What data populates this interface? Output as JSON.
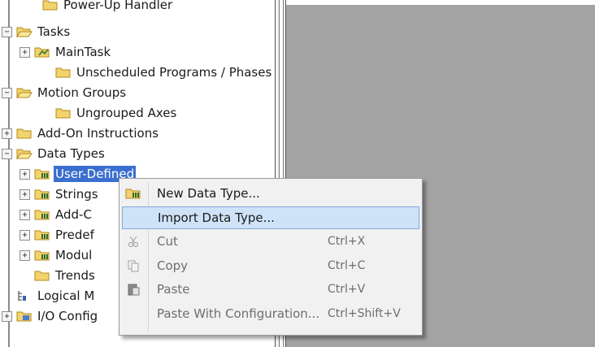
{
  "tree": {
    "items": [
      {
        "label": "Power-Up Handler",
        "expander": "",
        "icon": "folder-icon"
      },
      {
        "label": "Tasks",
        "expander": "−",
        "icon": "folder-open-icon"
      },
      {
        "label": "MainTask",
        "expander": "+",
        "icon": "task-icon"
      },
      {
        "label": "Unscheduled Programs / Phases",
        "expander": "",
        "icon": "folder-icon"
      },
      {
        "label": "Motion Groups",
        "expander": "−",
        "icon": "folder-open-icon"
      },
      {
        "label": "Ungrouped Axes",
        "expander": "",
        "icon": "folder-icon"
      },
      {
        "label": "Add-On Instructions",
        "expander": "+",
        "icon": "folder-icon"
      },
      {
        "label": "Data Types",
        "expander": "−",
        "icon": "folder-open-icon"
      },
      {
        "label": "User-Defined",
        "expander": "+",
        "icon": "datatype-folder-icon",
        "selected": true
      },
      {
        "label": "Strings",
        "expander": "+",
        "icon": "datatype-folder-icon"
      },
      {
        "label": "Add-C",
        "expander": "+",
        "icon": "datatype-folder-icon"
      },
      {
        "label": "Predef",
        "expander": "+",
        "icon": "datatype-folder-icon"
      },
      {
        "label": "Modul",
        "expander": "+",
        "icon": "datatype-folder-icon"
      },
      {
        "label": "Trends",
        "expander": "",
        "icon": "folder-icon"
      },
      {
        "label": "Logical M",
        "expander": "",
        "icon": "logical-model-icon"
      },
      {
        "label": "I/O Config",
        "expander": "+",
        "icon": "io-config-icon"
      }
    ]
  },
  "context_menu": {
    "items": [
      {
        "label": "New Data Type...",
        "shortcut": "",
        "icon": "datatype-folder-icon",
        "enabled": true
      },
      {
        "label": "Import Data Type...",
        "shortcut": "",
        "icon": "",
        "enabled": true,
        "highlighted": true
      },
      {
        "label": "Cut",
        "shortcut": "Ctrl+X",
        "icon": "scissors-icon",
        "enabled": false
      },
      {
        "label": "Copy",
        "shortcut": "Ctrl+C",
        "icon": "copy-icon",
        "enabled": false
      },
      {
        "label": "Paste",
        "shortcut": "Ctrl+V",
        "icon": "paste-icon",
        "enabled": false
      },
      {
        "label": "Paste With Configuration...",
        "shortcut": "Ctrl+Shift+V",
        "icon": "",
        "enabled": false
      }
    ]
  },
  "colors": {
    "selection": "#3a6fd0",
    "menu_highlight": "#cfe3f8",
    "content_background": "#a3a3a3"
  }
}
